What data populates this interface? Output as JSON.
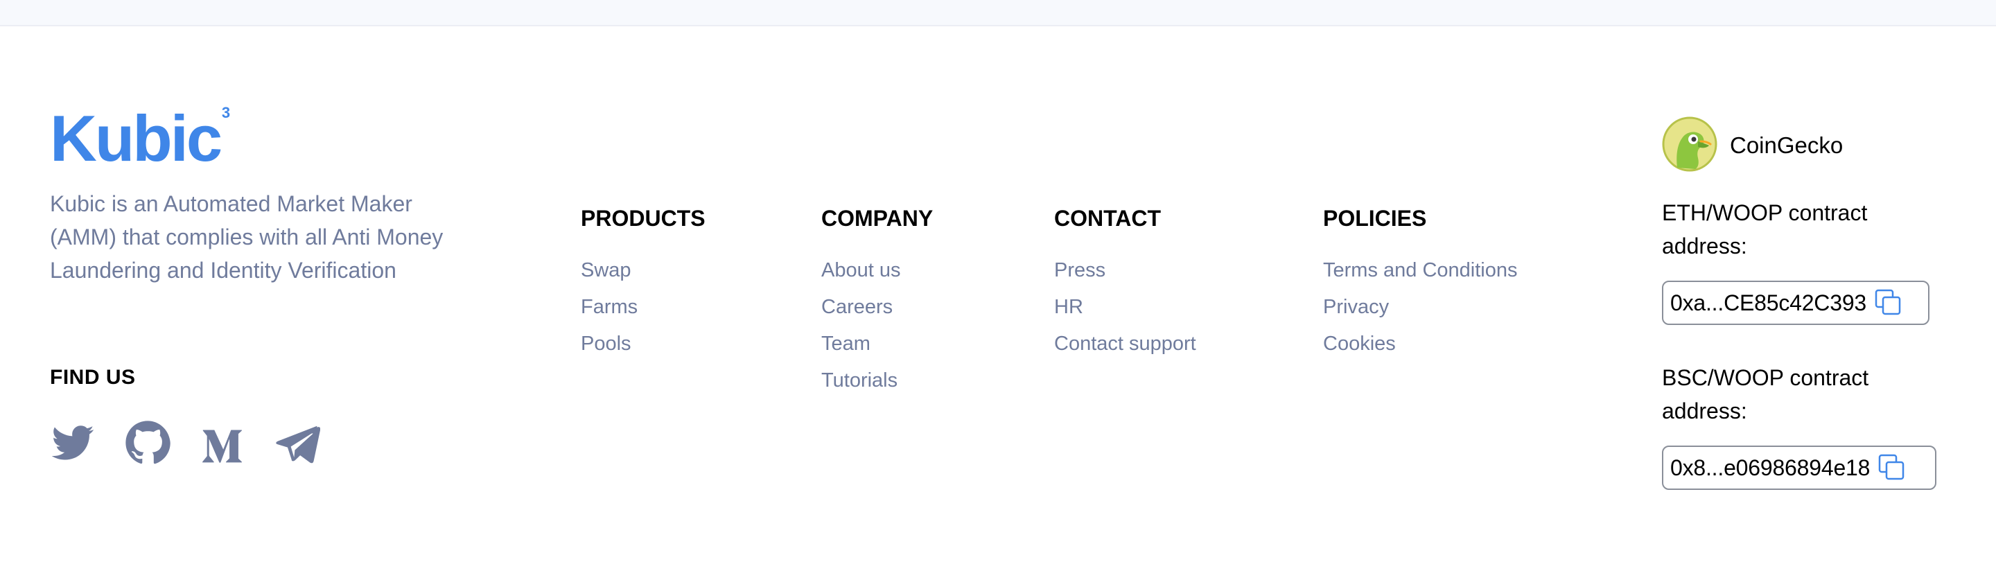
{
  "brand": {
    "name": "Kubic",
    "superscript": "3",
    "description": "Kubic is an Automated Market Maker (AMM) that complies with all Anti Money Laundering and Identity Verification"
  },
  "find_us": {
    "heading": "FIND US",
    "icons": [
      "twitter-icon",
      "github-icon",
      "medium-icon",
      "telegram-icon"
    ]
  },
  "columns": {
    "products": {
      "heading": "PRODUCTS",
      "links": [
        "Swap",
        "Farms",
        "Pools"
      ]
    },
    "company": {
      "heading": "COMPANY",
      "links": [
        "About us",
        "Careers",
        "Team",
        "Tutorials"
      ]
    },
    "contact": {
      "heading": "CONTACT",
      "links": [
        "Press",
        "HR",
        "Contact support"
      ]
    },
    "policies": {
      "heading": "POLICIES",
      "links": [
        "Terms and Conditions",
        "Privacy",
        "Cookies"
      ]
    }
  },
  "coingecko": {
    "label": "CoinGecko"
  },
  "contracts": {
    "eth": {
      "label": "ETH/WOOP contract address:",
      "value": "0xa...CE85c42C393"
    },
    "bsc": {
      "label": "BSC/WOOP contract address:",
      "value": "0x8...e06986894e18"
    }
  },
  "colors": {
    "brand_blue": "#3f86e8",
    "muted_text": "#6f7b9c",
    "top_bar": "#f7f9fd"
  }
}
